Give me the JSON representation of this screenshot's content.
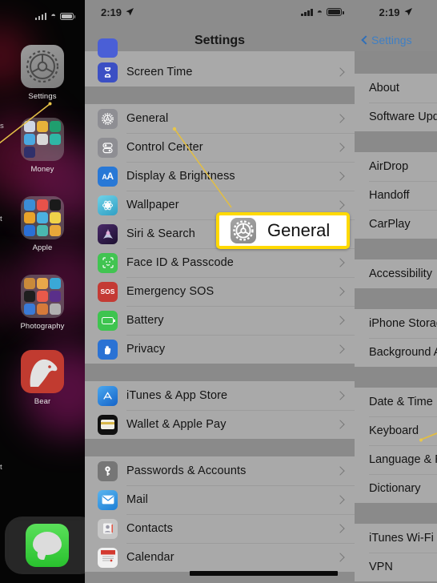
{
  "home": {
    "status": {
      "signal_icon": "cellular-bars-icon",
      "wifi_icon": "wifi-icon",
      "battery_icon": "battery-icon"
    },
    "apps": [
      {
        "label": "Settings",
        "icon": "settings-gear-icon"
      },
      {
        "label": "Money",
        "icon": "folder-icon"
      },
      {
        "label": "Apple",
        "icon": "folder-icon"
      },
      {
        "label": "Photography",
        "icon": "folder-icon"
      },
      {
        "label": "Bear",
        "icon": "bear-app-icon"
      }
    ],
    "dock": {
      "icon": "messages-icon"
    },
    "stray_left_labels": [
      "s",
      "t",
      "t"
    ]
  },
  "settings": {
    "status": {
      "time": "2:19",
      "location_icon": "location-arrow-icon",
      "signal_icon": "cellular-bars-icon",
      "wifi_icon": "wifi-icon",
      "battery_icon": "battery-icon"
    },
    "title": "Settings",
    "groups": [
      {
        "items": [
          {
            "label": "Screen Time",
            "icon": "screen-time-icon",
            "color": "#3b4fc4"
          }
        ]
      },
      {
        "items": [
          {
            "label": "General",
            "icon": "general-gear-icon",
            "color": "#8e8e93"
          },
          {
            "label": "Control Center",
            "icon": "control-center-icon",
            "color": "#8e8e93"
          },
          {
            "label": "Display & Brightness",
            "icon": "display-brightness-icon",
            "color": "#2878d6"
          },
          {
            "label": "Wallpaper",
            "icon": "wallpaper-icon",
            "color": "#4ab6d6"
          },
          {
            "label": "Siri & Search",
            "icon": "siri-icon",
            "color": "#2a1b45"
          },
          {
            "label": "Face ID & Passcode",
            "icon": "face-id-icon",
            "color": "#41c451"
          },
          {
            "label": "Emergency SOS",
            "icon": "sos-icon",
            "color": "#c43a34"
          },
          {
            "label": "Battery",
            "icon": "battery-settings-icon",
            "color": "#3ec44f"
          },
          {
            "label": "Privacy",
            "icon": "privacy-hand-icon",
            "color": "#2a72d4"
          }
        ]
      },
      {
        "items": [
          {
            "label": "iTunes & App Store",
            "icon": "app-store-icon",
            "color": "#2a82e0"
          },
          {
            "label": "Wallet & Apple Pay",
            "icon": "wallet-icon",
            "color": "#101010"
          }
        ]
      },
      {
        "items": [
          {
            "label": "Passwords & Accounts",
            "icon": "passwords-key-icon",
            "color": "#767676"
          },
          {
            "label": "Mail",
            "icon": "mail-icon",
            "color": "#2a8ae0"
          },
          {
            "label": "Contacts",
            "icon": "contacts-icon",
            "color": "#b5b5b5"
          },
          {
            "label": "Calendar",
            "icon": "calendar-icon",
            "color": "#e8e8e8",
            "redacted": true
          }
        ]
      }
    ],
    "chevron_icon": "chevron-right-icon"
  },
  "general": {
    "status": {
      "time": "2:19",
      "location_icon": "location-arrow-icon"
    },
    "back_label": "Settings",
    "back_icon": "chevron-left-icon",
    "groups": [
      {
        "items": [
          {
            "label": "About"
          },
          {
            "label": "Software Upda"
          }
        ]
      },
      {
        "items": [
          {
            "label": "AirDrop"
          },
          {
            "label": "Handoff"
          },
          {
            "label": "CarPlay"
          }
        ]
      },
      {
        "items": [
          {
            "label": "Accessibility"
          }
        ]
      },
      {
        "items": [
          {
            "label": "iPhone Storag"
          },
          {
            "label": "Background A"
          }
        ]
      },
      {
        "items": [
          {
            "label": "Date & Time"
          },
          {
            "label": "Keyboard"
          },
          {
            "label": "Language & R"
          },
          {
            "label": "Dictionary"
          }
        ]
      },
      {
        "items": [
          {
            "label": "iTunes Wi-Fi S"
          },
          {
            "label": "VPN"
          }
        ]
      }
    ]
  },
  "callout": {
    "label": "General",
    "icon": "general-gear-icon",
    "border_color": "#ffd900",
    "background_color": "#ffffff"
  },
  "annotations": {
    "line_color": "#e8c64a"
  }
}
